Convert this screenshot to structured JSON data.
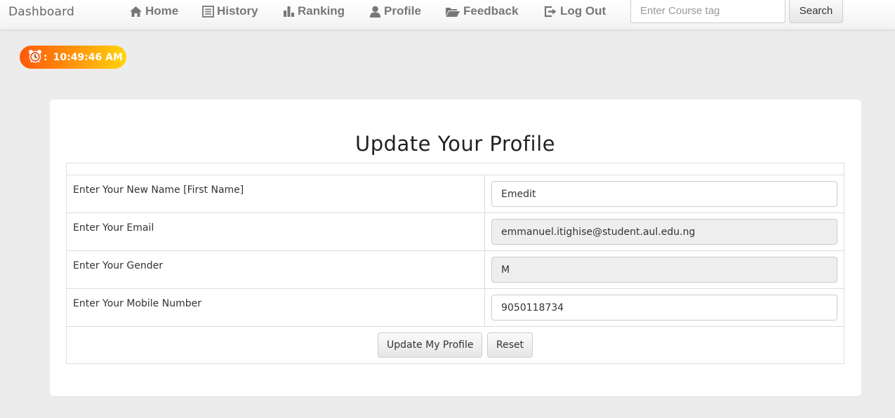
{
  "navbar": {
    "brand": "Dashboard",
    "items": [
      {
        "label": "Home",
        "icon": "home-icon"
      },
      {
        "label": "History",
        "icon": "list-icon"
      },
      {
        "label": "Ranking",
        "icon": "bar-chart-icon"
      },
      {
        "label": "Profile",
        "icon": "user-icon"
      },
      {
        "label": "Feedback",
        "icon": "folder-open-icon"
      },
      {
        "label": "Log Out",
        "icon": "log-out-icon"
      }
    ],
    "search": {
      "placeholder": "Enter Course tag",
      "button_label": "Search"
    }
  },
  "clock": {
    "icon": "alarm-clock-icon",
    "separator": ":",
    "time": "10:49:46 AM"
  },
  "form": {
    "title": "Update Your Profile",
    "fields": [
      {
        "label": "Enter Your New Name [First Name]",
        "value": "Emedit",
        "readonly": false
      },
      {
        "label": "Enter Your Email",
        "value": "emmanuel.itighise@student.aul.edu.ng",
        "readonly": true
      },
      {
        "label": "Enter Your Gender",
        "value": "M",
        "readonly": true
      },
      {
        "label": "Enter Your Mobile Number",
        "value": "9050118734",
        "readonly": false
      }
    ],
    "submit_label": "Update My Profile",
    "reset_label": "Reset"
  },
  "colors": {
    "page_bg": "#ececec",
    "clock_gradient_start": "#ff5a0a",
    "clock_gradient_end": "#ffd40a",
    "nav_text": "#777777"
  }
}
